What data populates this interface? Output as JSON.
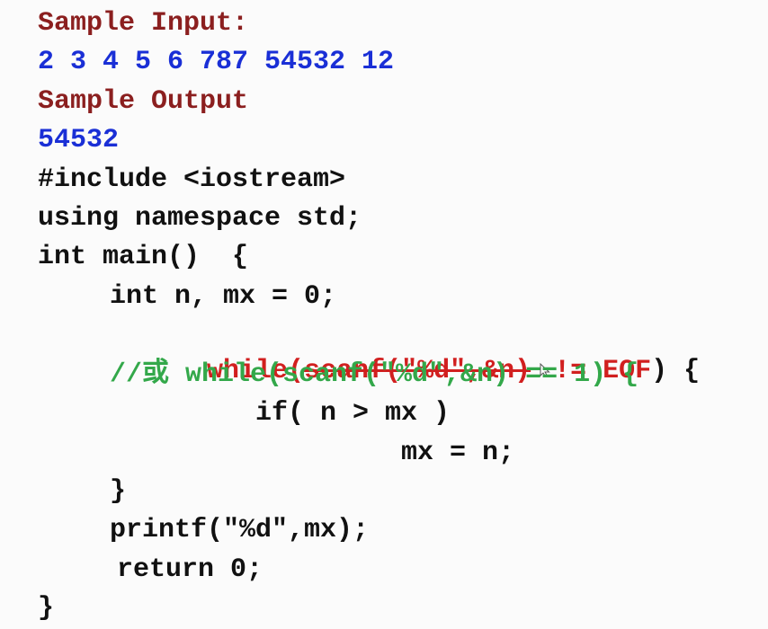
{
  "top_text": "",
  "sample_input_label": "Sample Input:",
  "sample_input_value": "2 3 4 5 6 787 54532 12",
  "sample_output_label": "Sample Output",
  "sample_output_value": "54532",
  "code": {
    "include": "#include <iostream>",
    "using": "using namespace std;",
    "main_open": "int main()  {",
    "decl": "int n, mx = 0;",
    "while_start": "while(",
    "while_struck": "scanf(\"%d\",&n)",
    "while_end": "!= EOF",
    "while_tail": ") {",
    "comment": "//或 while(scanf(\"%d\",&n) == 1) {",
    "if_stmt": "if( n > mx )",
    "assign": "mx = n;",
    "inner_close": "}",
    "printf": "printf(\"%d\",mx);",
    "return_stmt": "return 0;",
    "main_close": "}"
  },
  "colors": {
    "label_red": "#8b1f1f",
    "value_blue": "#1a2fd6",
    "code_black": "#111111",
    "edit_red": "#d11f1f",
    "comment_green": "#33a84a"
  },
  "icons": {
    "cursor": "mouse-pointer-icon"
  }
}
